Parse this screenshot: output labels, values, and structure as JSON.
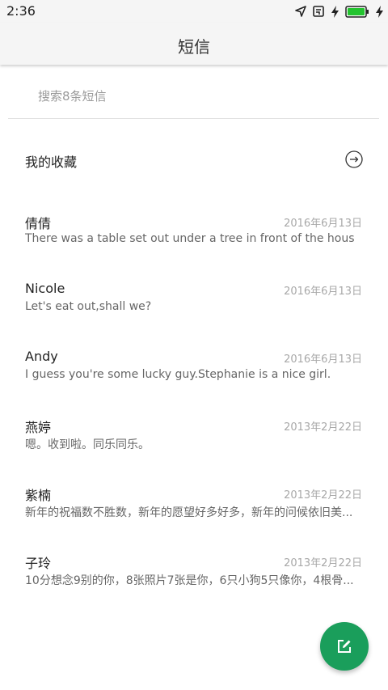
{
  "status_bar": {
    "time": "2:36",
    "icons": [
      "location-arrow-icon",
      "screen-rotate-icon",
      "charging-bolt-icon",
      "battery-icon",
      "charging-bolt-icon"
    ],
    "battery_color": "#22c32e"
  },
  "header": {
    "title": "短信"
  },
  "search": {
    "placeholder": "搜索8条短信"
  },
  "favorites": {
    "label": "我的收藏",
    "icon": "arrow-right-circle-icon"
  },
  "conversations": [
    {
      "name": "倩倩",
      "date": "2016年6月13日",
      "preview": "There was a table set out under a tree in front of the hous"
    },
    {
      "name": "Nicole",
      "date": "2016年6月13日",
      "preview": "Let's eat out,shall we?"
    },
    {
      "name": "Andy",
      "date": "2016年6月13日",
      "preview": "I guess you're some lucky guy.Stephanie is a nice girl."
    },
    {
      "name": "燕婷",
      "date": "2013年2月22日",
      "preview": "嗯。收到啦。同乐同乐。"
    },
    {
      "name": "紫楠",
      "date": "2013年2月22日",
      "preview": "新年的祝福数不胜数，新年的愿望好多好多，新年的问候依旧美..."
    },
    {
      "name": "子玲",
      "date": "2013年2月22日",
      "preview": "10分想念9别的你，8张照片7张是你，6只小狗5只像你，4根骨..."
    }
  ],
  "fab": {
    "icon": "compose-icon",
    "color": "#1a9e5b"
  }
}
